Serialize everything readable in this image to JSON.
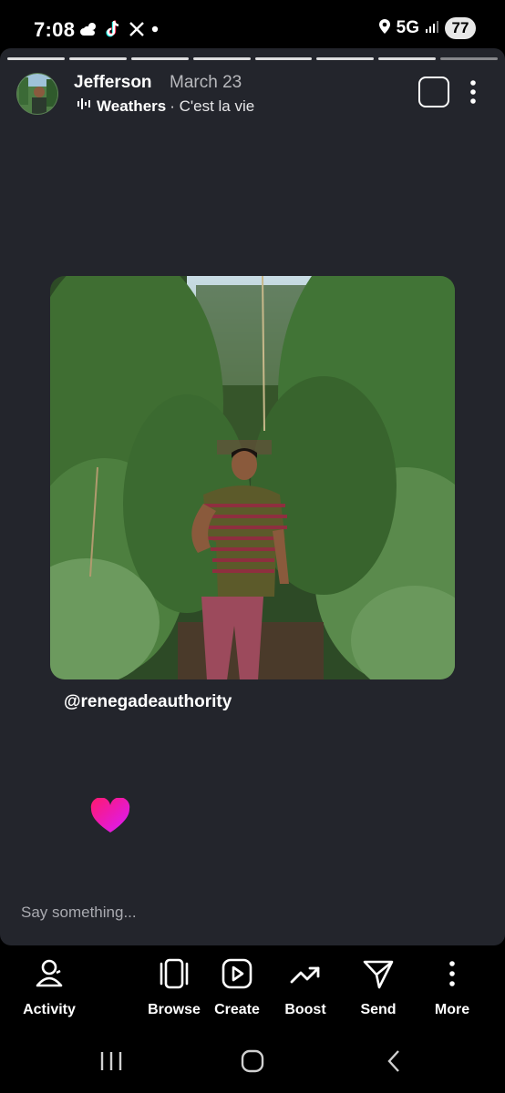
{
  "status": {
    "time": "7:08",
    "left_icons": [
      "cloud-sun-icon",
      "tiktok-icon",
      "x-logo-icon",
      "dot-icon"
    ],
    "network": "5G",
    "battery": "77"
  },
  "story": {
    "segments_total": 8,
    "user": "Jefferson",
    "date": "March 23",
    "music_song": "Weathers",
    "music_artist": "· C'est la vie",
    "mention": "@renegadeauthority",
    "reply_placeholder": "Say something..."
  },
  "actions": [
    {
      "label": "Activity",
      "icon": "activity-people-icon"
    },
    {
      "label": "Browse",
      "icon": "browse-cards-icon"
    },
    {
      "label": "Create",
      "icon": "create-play-icon"
    },
    {
      "label": "Boost",
      "icon": "boost-trend-icon"
    },
    {
      "label": "Send",
      "icon": "send-paper-plane-icon"
    },
    {
      "label": "More",
      "icon": "more-vertical-icon"
    }
  ],
  "colors": {
    "story_bg": "#23252c",
    "heart_gradient_top": "#ff1a6e",
    "heart_gradient_bottom": "#d81bff"
  }
}
